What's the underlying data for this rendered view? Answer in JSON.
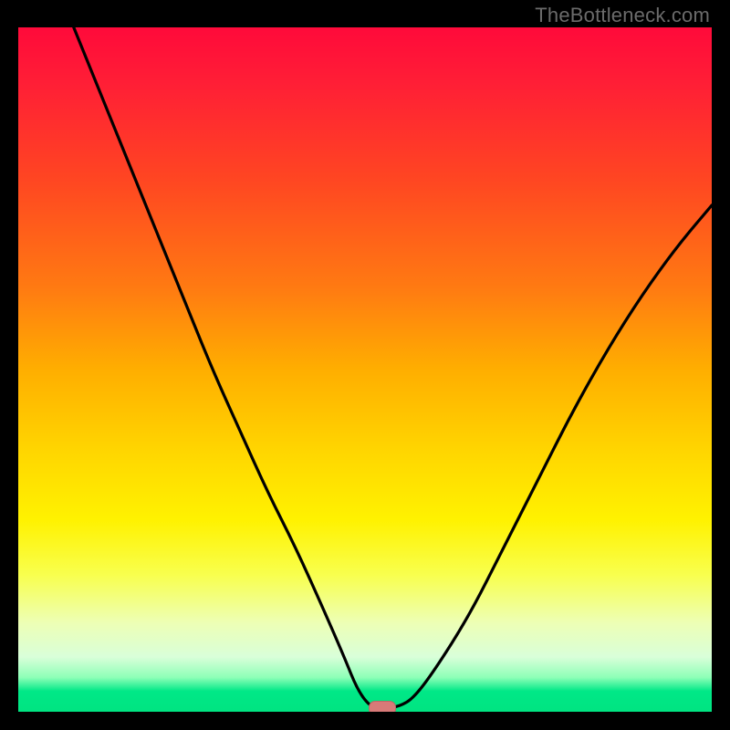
{
  "watermark": "TheBottleneck.com",
  "chart_data": {
    "type": "line",
    "title": "",
    "xlabel": "",
    "ylabel": "",
    "xlim": [
      0,
      100
    ],
    "ylim": [
      0,
      100
    ],
    "series": [
      {
        "name": "curve",
        "x": [
          8,
          12,
          16,
          20,
          24,
          28,
          32,
          36,
          40,
          44,
          47,
          49,
          51,
          53,
          55,
          57,
          60,
          65,
          70,
          75,
          80,
          85,
          90,
          95,
          100
        ],
        "y": [
          100,
          90,
          80,
          70,
          60,
          50,
          41,
          32,
          24,
          15,
          8,
          3,
          0.5,
          0.5,
          0.8,
          2,
          6,
          14,
          24,
          34,
          44,
          53,
          61,
          68,
          74
        ]
      }
    ],
    "marker": {
      "x": 52.5,
      "y": 0.5,
      "color": "#d87a78"
    },
    "background_gradient": {
      "stops": [
        {
          "pos": 0,
          "color": "#ff0a3a"
        },
        {
          "pos": 50,
          "color": "#ffae00"
        },
        {
          "pos": 80,
          "color": "#f8ff4e"
        },
        {
          "pos": 100,
          "color": "#00e481"
        }
      ]
    }
  }
}
